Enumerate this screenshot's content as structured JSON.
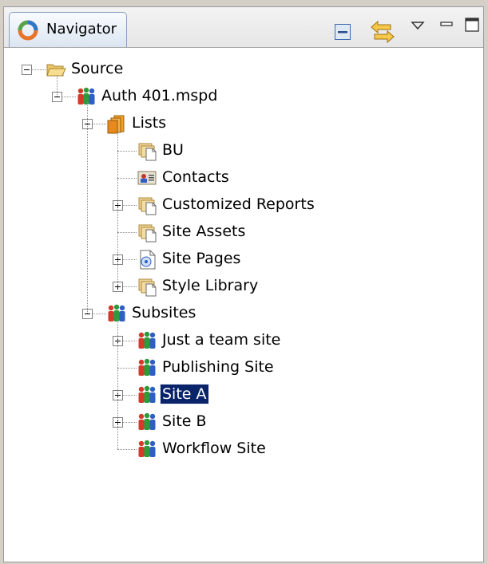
{
  "view": {
    "tab_title": "Navigator",
    "toolbar_icons": [
      "collapse-all-icon",
      "link-with-editor-icon",
      "view-menu-icon",
      "minimize-icon",
      "maximize-icon"
    ]
  },
  "tree": [
    {
      "label": "Source",
      "icon": "folder-open-icon",
      "expander": "minus",
      "selected": false
    },
    {
      "label": "Auth 401.mspd",
      "icon": "site-people-icon",
      "expander": "minus",
      "selected": false
    },
    {
      "label": "Lists",
      "icon": "lists-icon",
      "expander": "minus",
      "selected": false
    },
    {
      "label": "BU",
      "icon": "document-library-icon",
      "expander": "none",
      "selected": false
    },
    {
      "label": "Contacts",
      "icon": "contacts-icon",
      "expander": "none",
      "selected": false
    },
    {
      "label": "Customized Reports",
      "icon": "document-library-icon",
      "expander": "plus",
      "selected": false
    },
    {
      "label": "Site Assets",
      "icon": "document-library-icon",
      "expander": "none",
      "selected": false
    },
    {
      "label": "Site Pages",
      "icon": "wiki-pages-icon",
      "expander": "plus",
      "selected": false
    },
    {
      "label": "Style Library",
      "icon": "document-library-icon",
      "expander": "plus",
      "selected": false
    },
    {
      "label": "Subsites",
      "icon": "site-people-icon",
      "expander": "minus",
      "selected": false
    },
    {
      "label": "Just a team site",
      "icon": "site-people-icon",
      "expander": "plus",
      "selected": false
    },
    {
      "label": "Publishing Site",
      "icon": "site-people-icon",
      "expander": "none",
      "selected": false
    },
    {
      "label": "Site A",
      "icon": "site-people-icon",
      "expander": "plus",
      "selected": true
    },
    {
      "label": "Site B",
      "icon": "site-people-icon",
      "expander": "plus",
      "selected": false
    },
    {
      "label": "Workflow Site",
      "icon": "site-people-icon",
      "expander": "none",
      "selected": false
    }
  ]
}
